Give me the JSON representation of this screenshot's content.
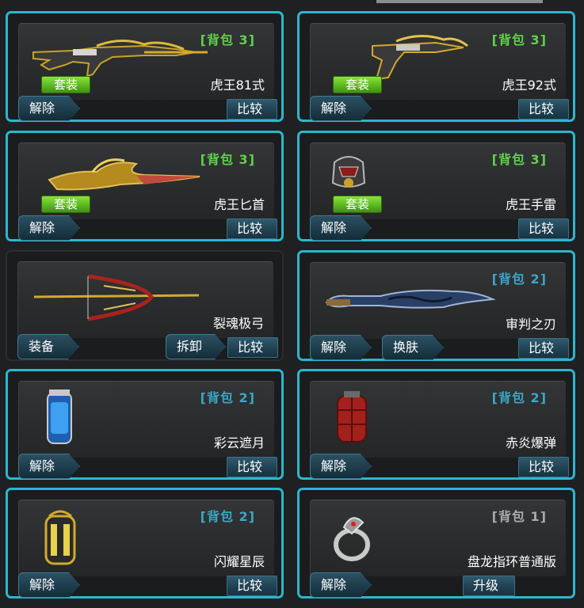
{
  "bag_prefix": "背包",
  "cards": [
    {
      "name": "虎王81式",
      "bag": "3",
      "bag_color": "green",
      "suit": "套装",
      "left_btn": "解除",
      "compare": "比较"
    },
    {
      "name": "虎王92式",
      "bag": "3",
      "bag_color": "green",
      "suit": "套装",
      "left_btn": "解除",
      "compare": "比较"
    },
    {
      "name": "虎王匕首",
      "bag": "3",
      "bag_color": "green",
      "suit": "套装",
      "left_btn": "解除",
      "compare": "比较"
    },
    {
      "name": "虎王手雷",
      "bag": "3",
      "bag_color": "green",
      "suit": "套装",
      "left_btn": "解除",
      "compare": "比较"
    },
    {
      "name": "裂魂极弓",
      "left_btn": "装备",
      "mid_btn": "拆卸",
      "compare": "比较"
    },
    {
      "name": "审判之刃",
      "bag": "2",
      "bag_color": "blue",
      "left_btn": "解除",
      "mid_btn": "换肤",
      "compare": "比较"
    },
    {
      "name": "彩云遮月",
      "bag": "2",
      "bag_color": "blue",
      "left_btn": "解除",
      "compare": "比较"
    },
    {
      "name": "赤炎爆弹",
      "bag": "2",
      "bag_color": "blue",
      "left_btn": "解除",
      "compare": "比较"
    },
    {
      "name": "闪耀星辰",
      "bag": "2",
      "bag_color": "blue",
      "left_btn": "解除",
      "compare": "比较"
    },
    {
      "name": "盘龙指环普通版",
      "bag": "1",
      "bag_color": "gray",
      "left_btn": "解除",
      "upgrade": "升级"
    }
  ],
  "colors": {
    "selected_border": "#2bb7cf",
    "bag_green": "#5fd14a",
    "bag_blue": "#3aa6c6",
    "bag_gray": "#a8abad",
    "suit_green": "#5cb821"
  },
  "icons": [
    "ak-rifle-icon",
    "pistol-icon",
    "dagger-icon",
    "grenade-helmet-icon",
    "bow-icon",
    "blade-icon",
    "canister-grenade-icon",
    "red-grenade-icon",
    "gold-canister-icon",
    "dragon-ring-icon"
  ]
}
